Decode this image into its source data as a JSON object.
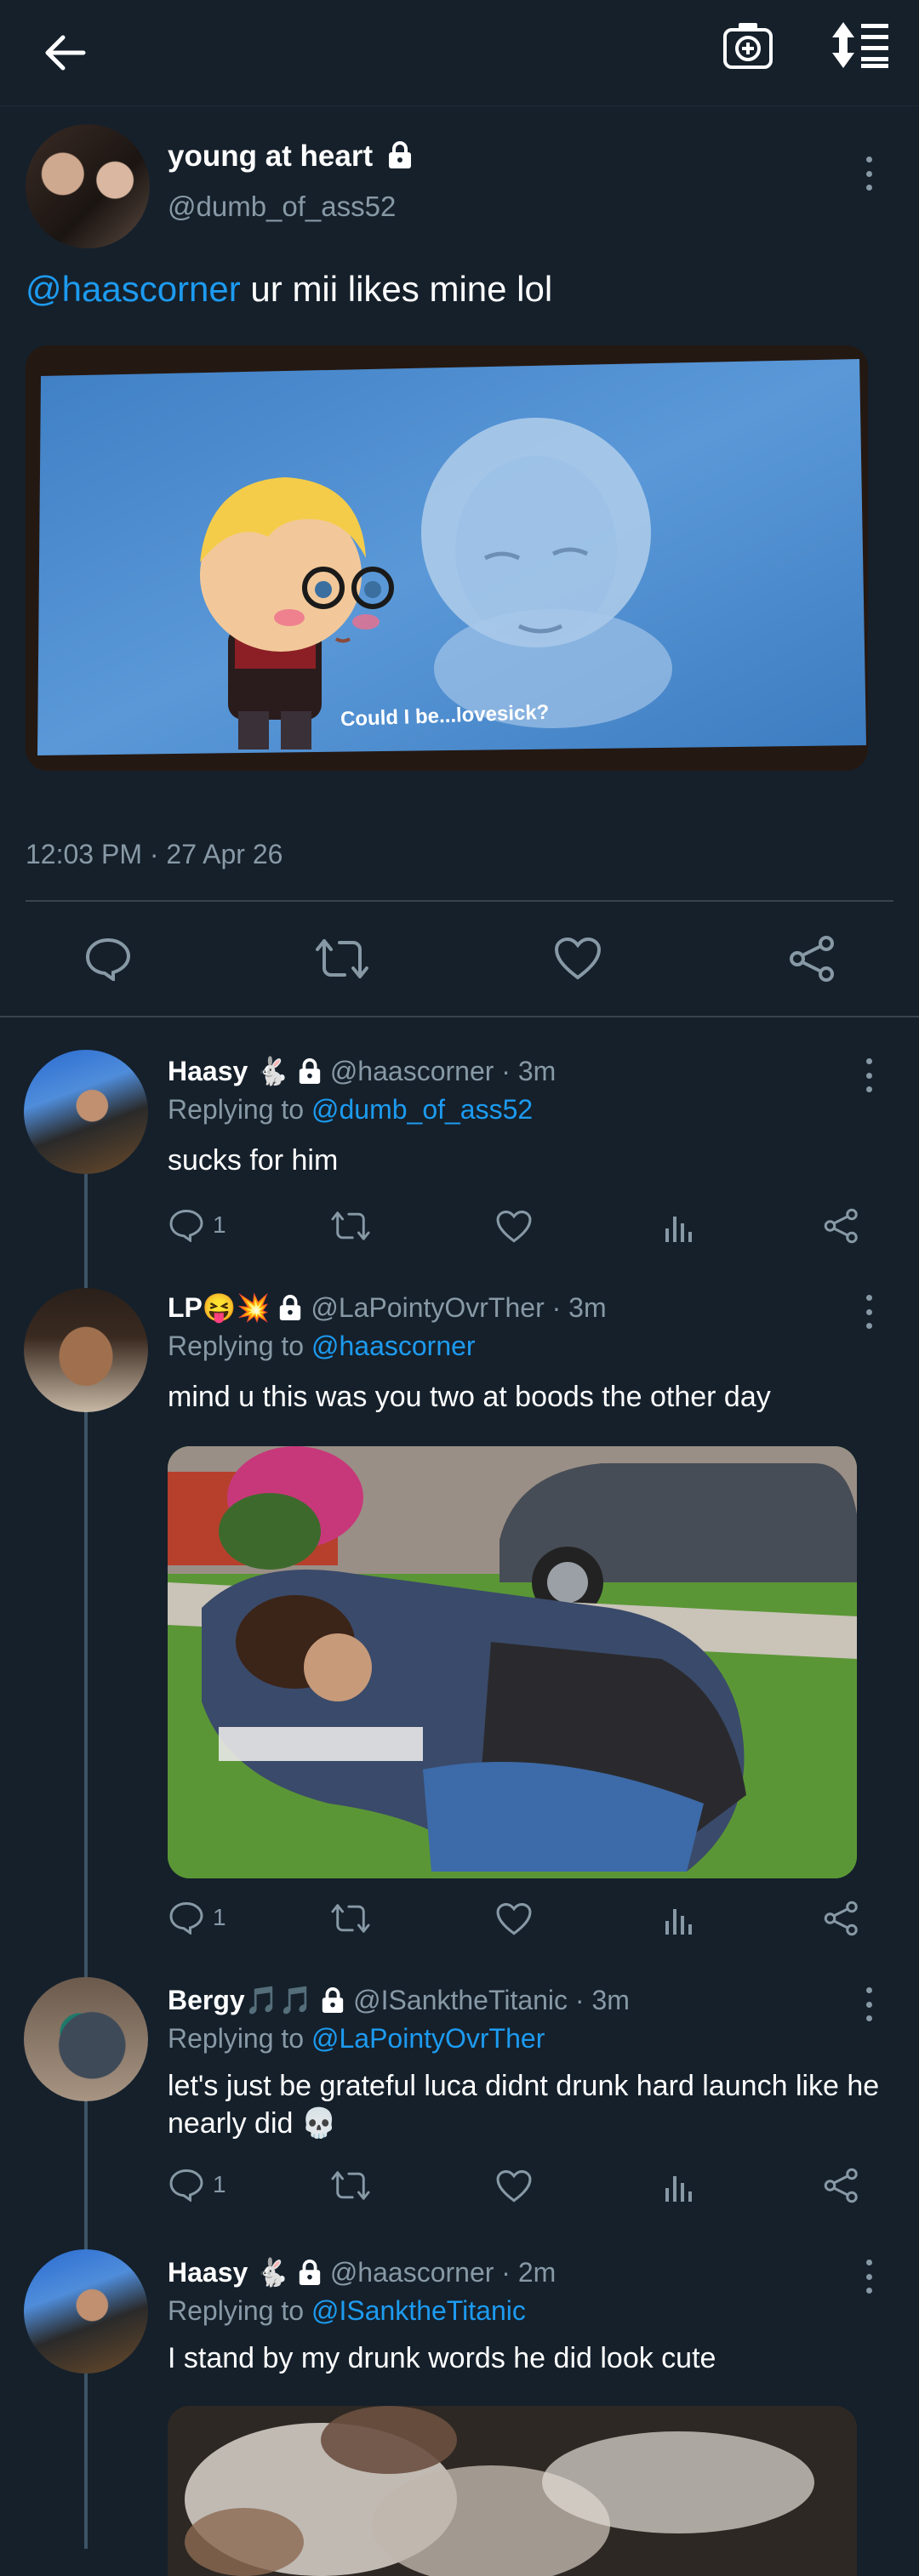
{
  "topbar": {
    "back": "arrow-left-icon",
    "camera": "camera-plus-icon",
    "sort": "sort-icon"
  },
  "tweet": {
    "display_name": "young at heart",
    "handle": "@dumb_of_ass52",
    "mention": "@haascorner",
    "text": " ur mii likes mine lol",
    "image_caption": "Could I be...lovesick?",
    "timestamp": "12:03 PM · 27 Apr 26"
  },
  "replies": [
    {
      "display_name": "Haasy",
      "emoji": "🐇",
      "handle": "@haascorner · 3m",
      "replying_label": "Replying to ",
      "replying_to": "@dumb_of_ass52",
      "text": "sucks for him",
      "reply_count": "1"
    },
    {
      "display_name": "LP",
      "emoji": "😝💥",
      "handle": "@LaPointyOvrTher · 3m",
      "replying_label": "Replying to ",
      "replying_to": "@haascorner",
      "text": "mind u this was you two at boods the other day",
      "reply_count": "1"
    },
    {
      "display_name": "Bergy",
      "emoji": "🎵🎵",
      "handle": "@ISanktheTitanic · 3m",
      "replying_label": "Replying to ",
      "replying_to": "@LaPointyOvrTher",
      "text": "let's just be grateful luca didnt drunk hard launch like he nearly did 💀",
      "reply_count": "1"
    },
    {
      "display_name": "Haasy",
      "emoji": "🐇",
      "handle": "@haascorner · 2m",
      "replying_label": "Replying to ",
      "replying_to": "@ISanktheTitanic",
      "text": "I stand by my drunk words he did look cute"
    }
  ],
  "colors": {
    "background": "#15202b",
    "link": "#1d9bf0",
    "muted": "#8899a6",
    "divider": "#38444d"
  }
}
